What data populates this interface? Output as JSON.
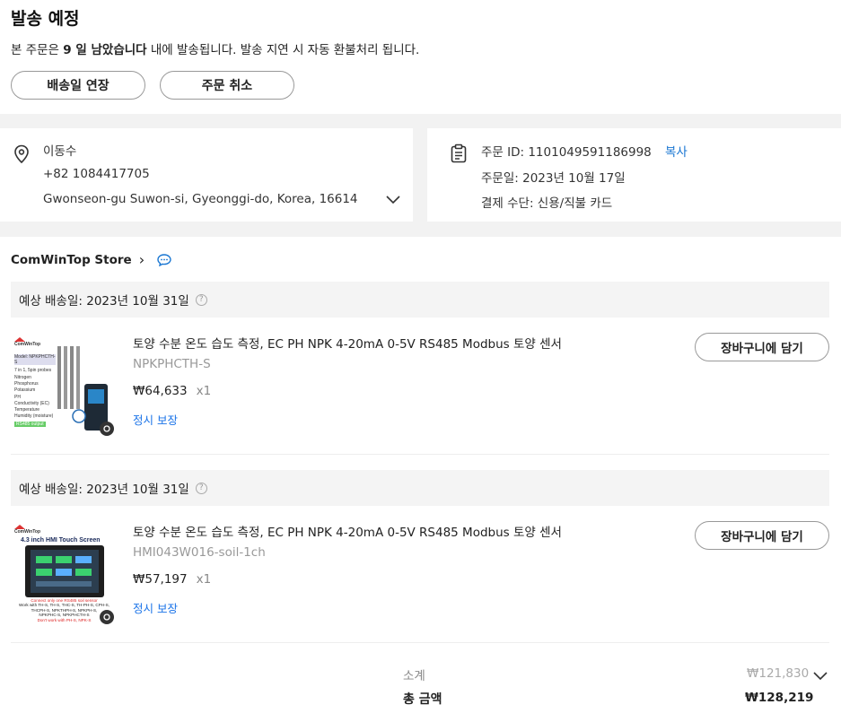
{
  "header": {
    "title": "발송 예정",
    "notice_prefix": "본 주문은 ",
    "notice_bold": "9 일 남았습니다",
    "notice_suffix": " 내에 발송됩니다. 발송 지연 시 자동 환불처리 됩니다.",
    "extend_button": "배송일 연장",
    "cancel_button": "주문 취소"
  },
  "address": {
    "name": "이동수",
    "phone": "+82 1084417705",
    "line": "Gwonseon-gu Suwon-si, Gyeonggi-do, Korea, 16614"
  },
  "order": {
    "id_line": "주문 ID: 1101049591186998",
    "copy_label": "복사",
    "date_line": "주문일: 2023년 10월 17일",
    "payment_line": "결제 수단: 신용/직불 카드"
  },
  "store": {
    "name": "ComWinTop Store",
    "chevron": "›"
  },
  "items": [
    {
      "ship_date": "예상 배송일: 2023년 10월 31일",
      "title": "토양 수분 온도 습도 측정, EC PH NPK 4-20mA 0-5V RS485 Modbus 토양 센서",
      "sku": "NPKPHCTH-S",
      "price": "₩64,633",
      "qty": "x1",
      "guarantee": "정시 보장",
      "cart_button": "장바구니에 담기",
      "thumb": {
        "brand": "ComWinTop",
        "model": "Model: NPKPHCTH-S",
        "heading": "7 in 1, 5pin probes",
        "features": [
          "Nitrogen",
          "Phosphorus",
          "Potassium",
          "PH",
          "Conductivity (EC)",
          "Temperature",
          "Humidity (moisture)"
        ],
        "output": "RS485 output"
      }
    },
    {
      "ship_date": "예상 배송일: 2023년 10월 31일",
      "title": "토양 수분 온도 습도 측정, EC PH NPK 4-20mA 0-5V RS485 Modbus 토양 센서",
      "sku": "HMI043W016-soil-1ch",
      "price": "₩57,197",
      "qty": "x1",
      "guarantee": "정시 보장",
      "cart_button": "장바구니에 담기",
      "thumb": {
        "brand": "ComWinTop",
        "heading": "4.3 inch HMI Touch Screen",
        "note1": "Connect only one RS485 soil sensor",
        "note2": "Work with TH-S, TH-S, THC-S, TH-PH-S, CPH-S,",
        "note3": "THCPH-S, NPKTHPH-S, NPKPH-S,",
        "note4": "NPKPHC-S, NPKPHCTH-S",
        "note5": "Don't work with PH-S, NPK-S"
      }
    }
  ],
  "summary": {
    "subtotal_label": "소계",
    "subtotal_value": "₩121,830",
    "total_label": "총 금액",
    "total_value": "₩128,219"
  },
  "colors": {
    "link": "#1976d2",
    "band": "#f2f2f2"
  }
}
